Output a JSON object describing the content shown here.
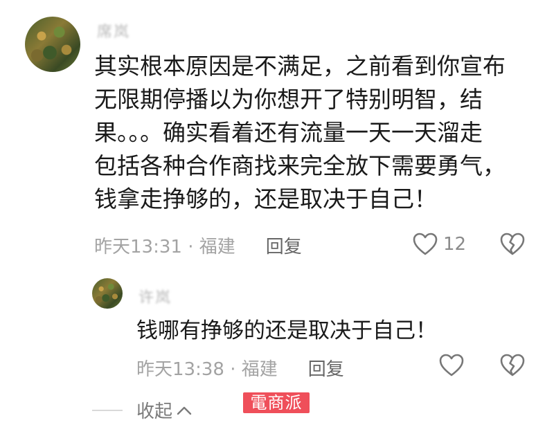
{
  "main_comment": {
    "username": "席岚",
    "text_lines": [
      "其实根本原因是不满足，之前看到你宣布",
      "无限期停播以为你想开了特别明智，结",
      "果。。。确实看着还有流量一天一天溜走",
      "包括各种合作商找来完全放下需要勇气，",
      "钱拿走挣够的，还是取决于自己！"
    ],
    "time_location": "昨天13:31 · 福建",
    "reply_label": "回复",
    "like_count": "12"
  },
  "reply_comment": {
    "username": "许岚",
    "text": "钱哪有挣够的还是取决于自己！",
    "time_location": "昨天13:38 · 福建",
    "reply_label": "回复"
  },
  "collapse_label": "收起",
  "watermark_text": "電商派",
  "colors": {
    "text": "#1a1a1a",
    "meta": "#a3a3a3",
    "watermark_bg": "#ef4f5a"
  }
}
